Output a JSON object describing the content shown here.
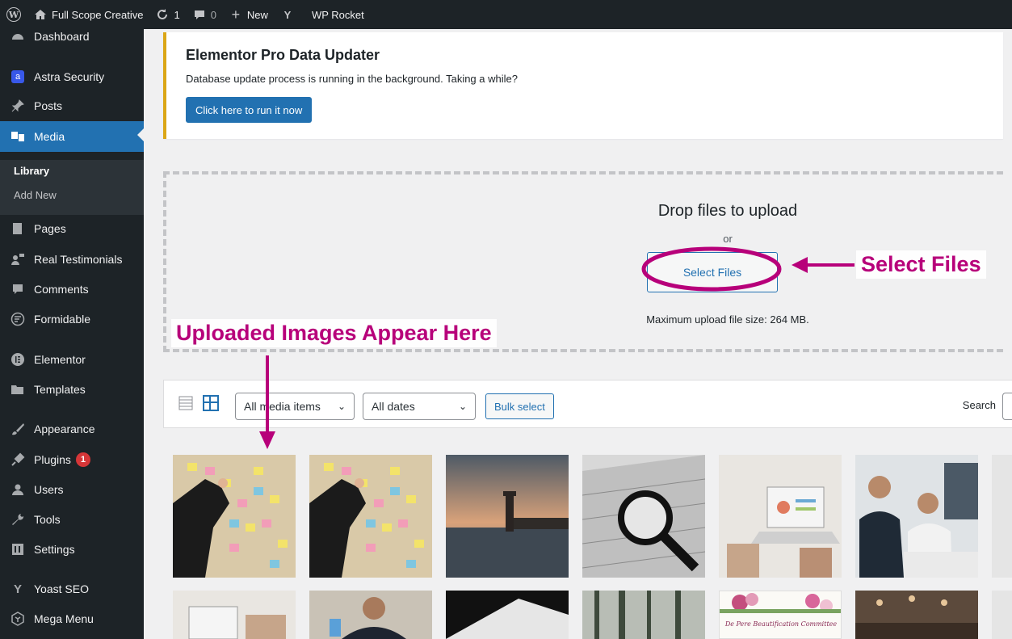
{
  "adminbar": {
    "site_name": "Full Scope Creative",
    "updates_count": "1",
    "comments_count": "0",
    "new_label": "New",
    "rocket_label": "WP Rocket"
  },
  "sidebar": {
    "items": [
      {
        "label": "Dashboard",
        "icon": "dashboard-icon"
      },
      {
        "label": "Astra Security",
        "icon": "astra-icon"
      },
      {
        "label": "Posts",
        "icon": "pin-icon"
      },
      {
        "label": "Media",
        "icon": "media-icon"
      },
      {
        "label": "Pages",
        "icon": "page-icon"
      },
      {
        "label": "Real Testimonials",
        "icon": "testimonial-icon"
      },
      {
        "label": "Comments",
        "icon": "comment-icon"
      },
      {
        "label": "Formidable",
        "icon": "formidable-icon"
      },
      {
        "label": "Elementor",
        "icon": "elementor-icon"
      },
      {
        "label": "Templates",
        "icon": "folder-icon"
      },
      {
        "label": "Appearance",
        "icon": "brush-icon"
      },
      {
        "label": "Plugins",
        "icon": "plug-icon",
        "badge": "1"
      },
      {
        "label": "Users",
        "icon": "users-icon"
      },
      {
        "label": "Tools",
        "icon": "wrench-icon"
      },
      {
        "label": "Settings",
        "icon": "settings-icon"
      },
      {
        "label": "Yoast SEO",
        "icon": "yoast-icon"
      },
      {
        "label": "Mega Menu",
        "icon": "mega-menu-icon"
      }
    ],
    "submenu": {
      "library": "Library",
      "add_new": "Add New"
    }
  },
  "notice": {
    "title": "Elementor Pro Data Updater",
    "text": "Database update process is running in the background. Taking a while?",
    "button": "Click here to run it now"
  },
  "uploader": {
    "title": "Drop files to upload",
    "or": "or",
    "select_button": "Select Files",
    "max_size": "Maximum upload file size: 264 MB."
  },
  "toolbar": {
    "filter_type": "All media items",
    "filter_date": "All dates",
    "bulk_select": "Bulk select",
    "search_label": "Search"
  },
  "annotations": {
    "select_files": "Select Files",
    "uploaded_images": "Uploaded Images Appear Here",
    "color": "#b7007a"
  },
  "media": {
    "row2_caption": "De Pere Beautification Committee"
  }
}
